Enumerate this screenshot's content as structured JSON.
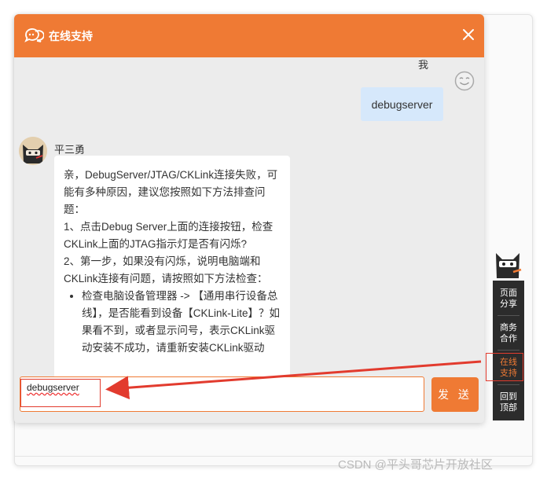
{
  "chat": {
    "title": "在线支持",
    "close_icon": "close-icon",
    "me": {
      "name": "我",
      "message": "debugserver",
      "avatar_icon": "smiley-avatar-icon"
    },
    "bot": {
      "name": "平三勇",
      "avatar_icon": "ninja-avatar-icon",
      "lines": [
        "亲，DebugServer/JTAG/CKLink连接失败，可能有多种原因，建议您按照如下方法排查问题：",
        "1、点击Debug Server上面的连接按钮，检查CKLink上面的JTAG指示灯是否有闪烁?",
        "2、第一步，如果没有闪烁，说明电脑端和CKLink连接有问题，请按照如下方法检查："
      ],
      "bullets": [
        "检查电脑设备管理器 -> 【通用串行设备总线】，是否能看到设备【CKLink-Lite】？如果看不到，或者显示问号，表示CKLink驱动安装不成功，请重新安装CKLink驱动"
      ]
    },
    "input": {
      "value": "debugserver"
    },
    "send_label": "发 送"
  },
  "sidebar": {
    "items": [
      {
        "label": "页面分享",
        "active": false
      },
      {
        "label": "商务合作",
        "active": false
      },
      {
        "label": "在线支持",
        "active": true
      },
      {
        "label": "回到顶部",
        "active": false
      }
    ]
  },
  "watermark": "CSDN @平头哥芯片开放社区",
  "colors": {
    "accent": "#ef7a34",
    "annotation": "#e23b2e",
    "me_bubble": "#d6e8fb",
    "sidebar": "#2c2c2c"
  }
}
